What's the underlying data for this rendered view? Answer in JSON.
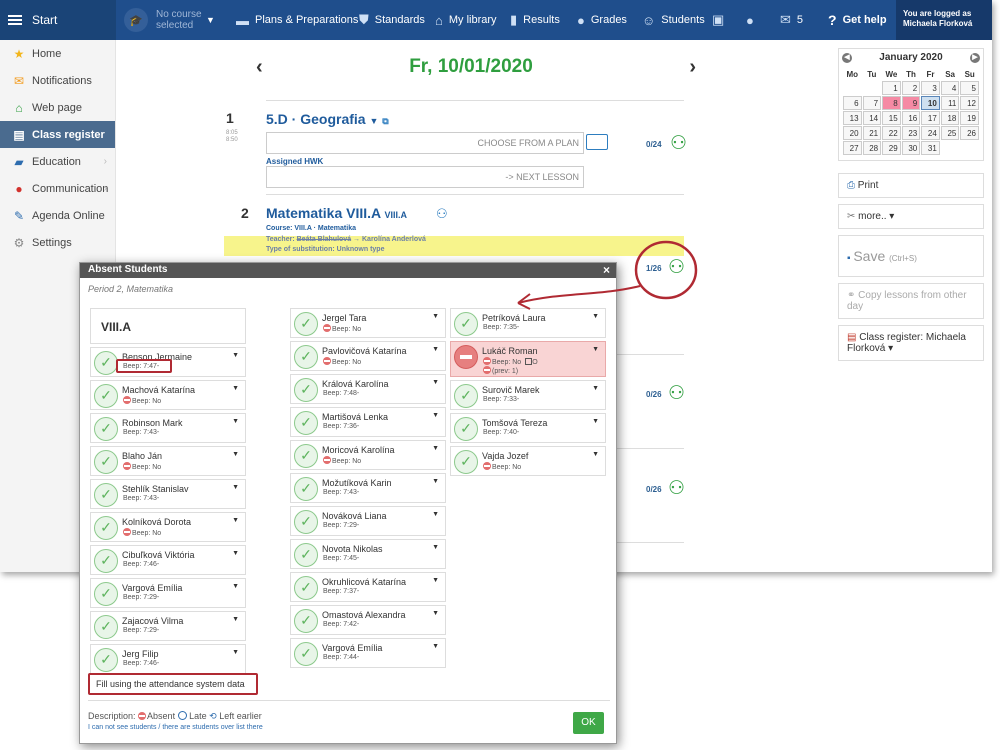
{
  "topbar": {
    "start": "Start",
    "course_line1": "No course",
    "course_line2": "selected",
    "nav": [
      {
        "label": "Plans & Preparations",
        "icon": "briefcase-icon"
      },
      {
        "label": "Standards",
        "icon": "shield-icon"
      },
      {
        "label": "My library",
        "icon": "library-icon"
      },
      {
        "label": "Results",
        "icon": "bar-chart-icon"
      },
      {
        "label": "Grades",
        "icon": "grades-icon"
      },
      {
        "label": "Students",
        "icon": "students-icon"
      }
    ],
    "message_count": "5",
    "help": "Get help",
    "logged_line1": "You are logged as",
    "logged_line2": "Michaela Florková"
  },
  "sidebar": {
    "items": [
      {
        "label": "Home",
        "icon": "star-icon"
      },
      {
        "label": "Notifications",
        "icon": "envelope-icon"
      },
      {
        "label": "Web page",
        "icon": "house-icon"
      },
      {
        "label": "Class register",
        "icon": "register-icon"
      },
      {
        "label": "Education",
        "icon": "book-icon"
      },
      {
        "label": "Communication",
        "icon": "chat-icon"
      },
      {
        "label": "Agenda Online",
        "icon": "pen-icon"
      },
      {
        "label": "Settings",
        "icon": "gear-icon"
      }
    ]
  },
  "main": {
    "date": "Fr, 10/01/2020",
    "lesson1": {
      "num": "1",
      "title": "5.D · Geografia",
      "time1": "8:05",
      "time2": "8:50",
      "plan_placeholder": "CHOOSE FROM A PLAN",
      "hwk_label": "Assigned HWK",
      "next_lesson": "-> NEXT LESSON",
      "count": "0/24"
    },
    "lesson2": {
      "num": "2",
      "title": "Matematika",
      "class": "VIII.A",
      "class_small": "VIII.A",
      "course_line": "Course:  VIII.A · Matematika",
      "teacher_prefix": "Teacher:",
      "teacher_old": "Beáta Blahulová",
      "teacher_new": "→ Karolína Anderlová",
      "substitution": "Type of substitution:  Unknown type",
      "count": "1/26"
    },
    "count3": "0/26",
    "count4": "0/26"
  },
  "calendar": {
    "month": "January 2020",
    "days": [
      "Mo",
      "Tu",
      "We",
      "Th",
      "Fr",
      "Sa",
      "Su"
    ],
    "weeks": [
      [
        "",
        "",
        "1",
        "2",
        "3",
        "4",
        "5"
      ],
      [
        "6",
        "7",
        "8",
        "9",
        "10",
        "11",
        "12"
      ],
      [
        "13",
        "14",
        "15",
        "16",
        "17",
        "18",
        "19"
      ],
      [
        "20",
        "21",
        "22",
        "23",
        "24",
        "25",
        "26"
      ],
      [
        "27",
        "28",
        "29",
        "30",
        "31",
        "",
        ""
      ]
    ],
    "highlighted": [
      "8",
      "9"
    ],
    "today": "10"
  },
  "right": {
    "print": "Print",
    "more": "more.. ▾",
    "save": "Save",
    "save_shortcut": "(Ctrl+S)",
    "copy": "Copy lessons from other day",
    "register_line1": "Class register: Michaela",
    "register_line2": "Florková ▾"
  },
  "modal": {
    "title": "Absent Students",
    "close": "×",
    "subtitle": "Period 2, Matematika",
    "class_name": "VIII.A",
    "columns": [
      [
        {
          "name": "Benson Jermaine",
          "beep": "Beep: 7:47-"
        },
        {
          "name": "Machová Katarína",
          "beep": "Beep: No"
        },
        {
          "name": "Robinson Mark",
          "beep": "Beep: 7:43-"
        },
        {
          "name": "Blaho Ján",
          "beep": "Beep: No"
        },
        {
          "name": "Stehlík Stanislav",
          "beep": "Beep: 7:43-"
        },
        {
          "name": "Kolníková Dorota",
          "beep": "Beep: No"
        },
        {
          "name": "Cibuľková Viktória",
          "beep": "Beep: 7:46-"
        },
        {
          "name": "Vargová Emília",
          "beep": "Beep: 7:29-"
        },
        {
          "name": "Zajacová Vilma",
          "beep": "Beep: 7:29-"
        },
        {
          "name": "Jerg Filip",
          "beep": "Beep: 7:46-"
        }
      ],
      [
        {
          "name": "Jergel Tara",
          "beep": "Beep: No"
        },
        {
          "name": "Pavlovičová Katarína",
          "beep": "Beep: No"
        },
        {
          "name": "Králová Karolína",
          "beep": "Beep: 7:48-"
        },
        {
          "name": "Martišová Lenka",
          "beep": "Beep: 7:36-"
        },
        {
          "name": "Moricová Karolína",
          "beep": "Beep: No"
        },
        {
          "name": "Možutíková Karin",
          "beep": "Beep: 7:43-"
        },
        {
          "name": "Nováková Liana",
          "beep": "Beep: 7:29-"
        },
        {
          "name": "Novota Nikolas",
          "beep": "Beep: 7:45-"
        },
        {
          "name": "Okruhlicová Katarína",
          "beep": "Beep: 7:37-"
        },
        {
          "name": "Omastová Alexandra",
          "beep": "Beep: 7:42-"
        },
        {
          "name": "Vargová Emília",
          "beep": "Beep: 7:44-"
        }
      ],
      [
        {
          "name": "Petríková Laura",
          "beep": "Beep: 7:35-"
        },
        {
          "name": "Lukáč Roman",
          "beep": "Beep: No",
          "extra": "(prev: 1)",
          "box_label": "O",
          "absent": true
        },
        {
          "name": "Surovič Marek",
          "beep": "Beep: 7:33-"
        },
        {
          "name": "Tomšová Tereza",
          "beep": "Beep: 7:40-"
        },
        {
          "name": "Vajda Jozef",
          "beep": "Beep: No"
        }
      ]
    ],
    "fill_button": "Fill using the attendance system data",
    "desc_label": "Description:",
    "absent": "Absent",
    "late": "Late",
    "left_earlier": "Left earlier",
    "cant_see": "I can not see students / there are students over list there",
    "ok": "OK"
  },
  "colors": {
    "topbar": "#1f4e8c",
    "accent_green": "#2f9e3f",
    "annotation_red": "#b02a33",
    "absent_red": "#e26d6d"
  }
}
